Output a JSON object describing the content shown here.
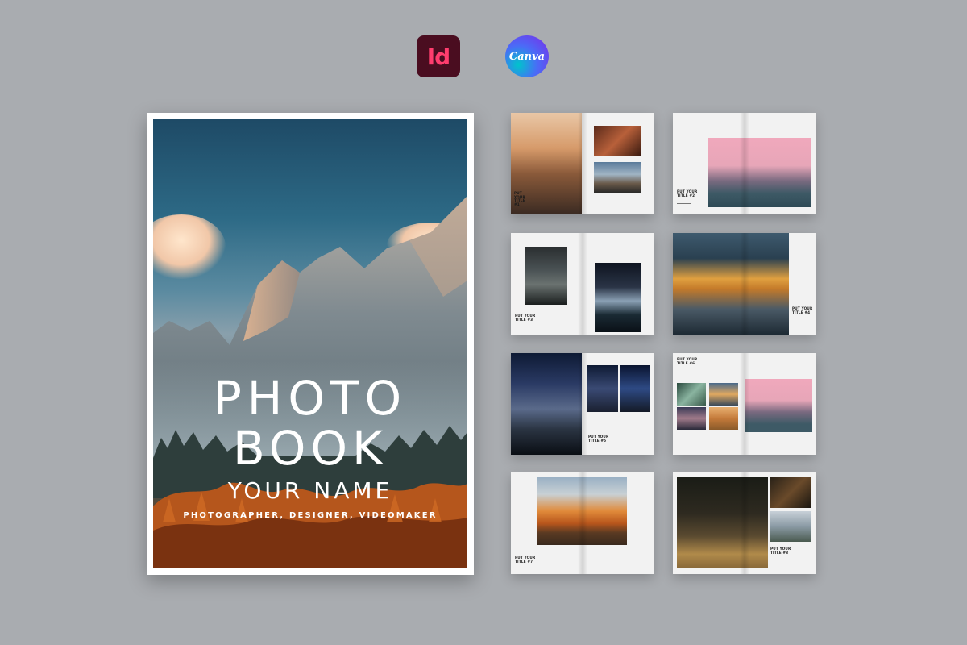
{
  "logos": {
    "indesign": {
      "label": "Id",
      "icon": "indesign-icon",
      "bg": "#4a0d20",
      "fg": "#ff3d6e"
    },
    "canva": {
      "label": "Canva",
      "icon": "canva-icon"
    }
  },
  "cover": {
    "title_line1": "PHOTO",
    "title_line2": "BOOK",
    "name": "YOUR NAME",
    "subtitle": "PHOTOGRAPHER, DESIGNER, VIDEOMAKER"
  },
  "spreads": {
    "s1": {
      "title": "PUT YOUR TITLE #1"
    },
    "s2": {
      "title": "PUT YOUR TITLE #2"
    },
    "s3": {
      "title": "PUT YOUR TITLE #3"
    },
    "s4": {
      "title": "PUT YOUR TITLE #4"
    },
    "s5": {
      "title": "PUT YOUR TITLE #5"
    },
    "s6": {
      "title": "PUT YOUR TITLE #6"
    },
    "s7": {
      "title": "PUT YOUR TITLE #7"
    },
    "s8": {
      "title": "PUT YOUR TITLE #8"
    }
  },
  "colors": {
    "background": "#a9acb0",
    "page": "#f2f2f2"
  }
}
